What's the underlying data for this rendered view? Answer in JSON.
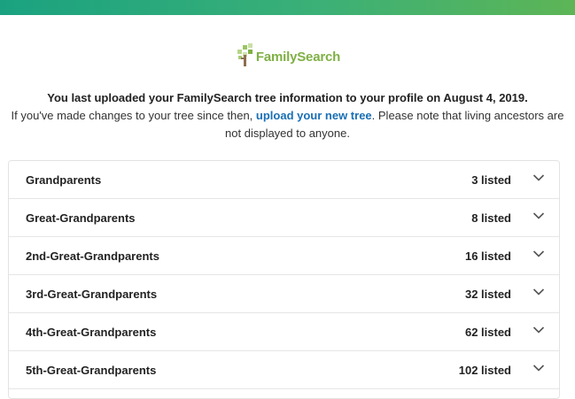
{
  "brand": {
    "logo_text": "FamilySearch",
    "logo_color": "#7fb045",
    "accent_gradient": [
      "#1aa280",
      "#3bb077",
      "#5db556"
    ]
  },
  "info": {
    "line1": "You last uploaded your FamilySearch tree information to your profile on August 4, 2019.",
    "line2_before": "If you've made changes to your tree since then, ",
    "line2_link": "upload your new tree",
    "line2_after": ". Please note that living ancestors are not displayed to anyone.",
    "link_color": "#1a6fb4"
  },
  "generations": [
    {
      "label": "Grandparents",
      "count": "3 listed"
    },
    {
      "label": "Great-Grandparents",
      "count": "8 listed"
    },
    {
      "label": "2nd-Great-Grandparents",
      "count": "16 listed"
    },
    {
      "label": "3rd-Great-Grandparents",
      "count": "32 listed"
    },
    {
      "label": "4th-Great-Grandparents",
      "count": "62 listed"
    },
    {
      "label": "5th-Great-Grandparents",
      "count": "102 listed"
    }
  ],
  "icons": {
    "expand": "chevron-down-icon",
    "logo": "family-tree-icon"
  }
}
